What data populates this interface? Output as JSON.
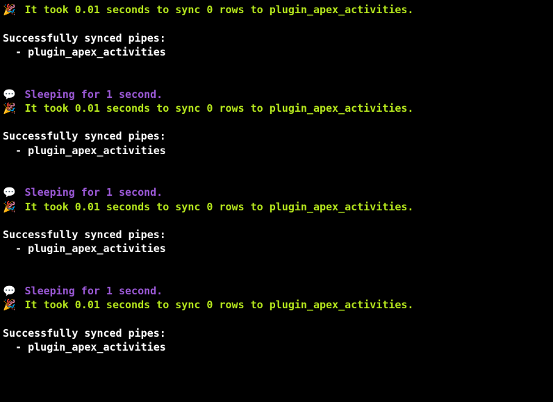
{
  "blocks": [
    {
      "sync_line": " It took 0.01 seconds to sync 0 rows to plugin_apex_activities.",
      "success_header": "Successfully synced pipes:",
      "success_item": "  - plugin_apex_activities",
      "has_sleep": false
    },
    {
      "sleep_line": " Sleeping for 1 second.",
      "sync_line": " It took 0.01 seconds to sync 0 rows to plugin_apex_activities.",
      "success_header": "Successfully synced pipes:",
      "success_item": "  - plugin_apex_activities",
      "has_sleep": true
    },
    {
      "sleep_line": " Sleeping for 1 second.",
      "sync_line": " It took 0.01 seconds to sync 0 rows to plugin_apex_activities.",
      "success_header": "Successfully synced pipes:",
      "success_item": "  - plugin_apex_activities",
      "has_sleep": true
    },
    {
      "sleep_line": " Sleeping for 1 second.",
      "sync_line": " It took 0.01 seconds to sync 0 rows to plugin_apex_activities.",
      "success_header": "Successfully synced pipes:",
      "success_item": "  - plugin_apex_activities",
      "has_sleep": true
    }
  ],
  "emoji_party": "🎉",
  "emoji_speech": "💬"
}
